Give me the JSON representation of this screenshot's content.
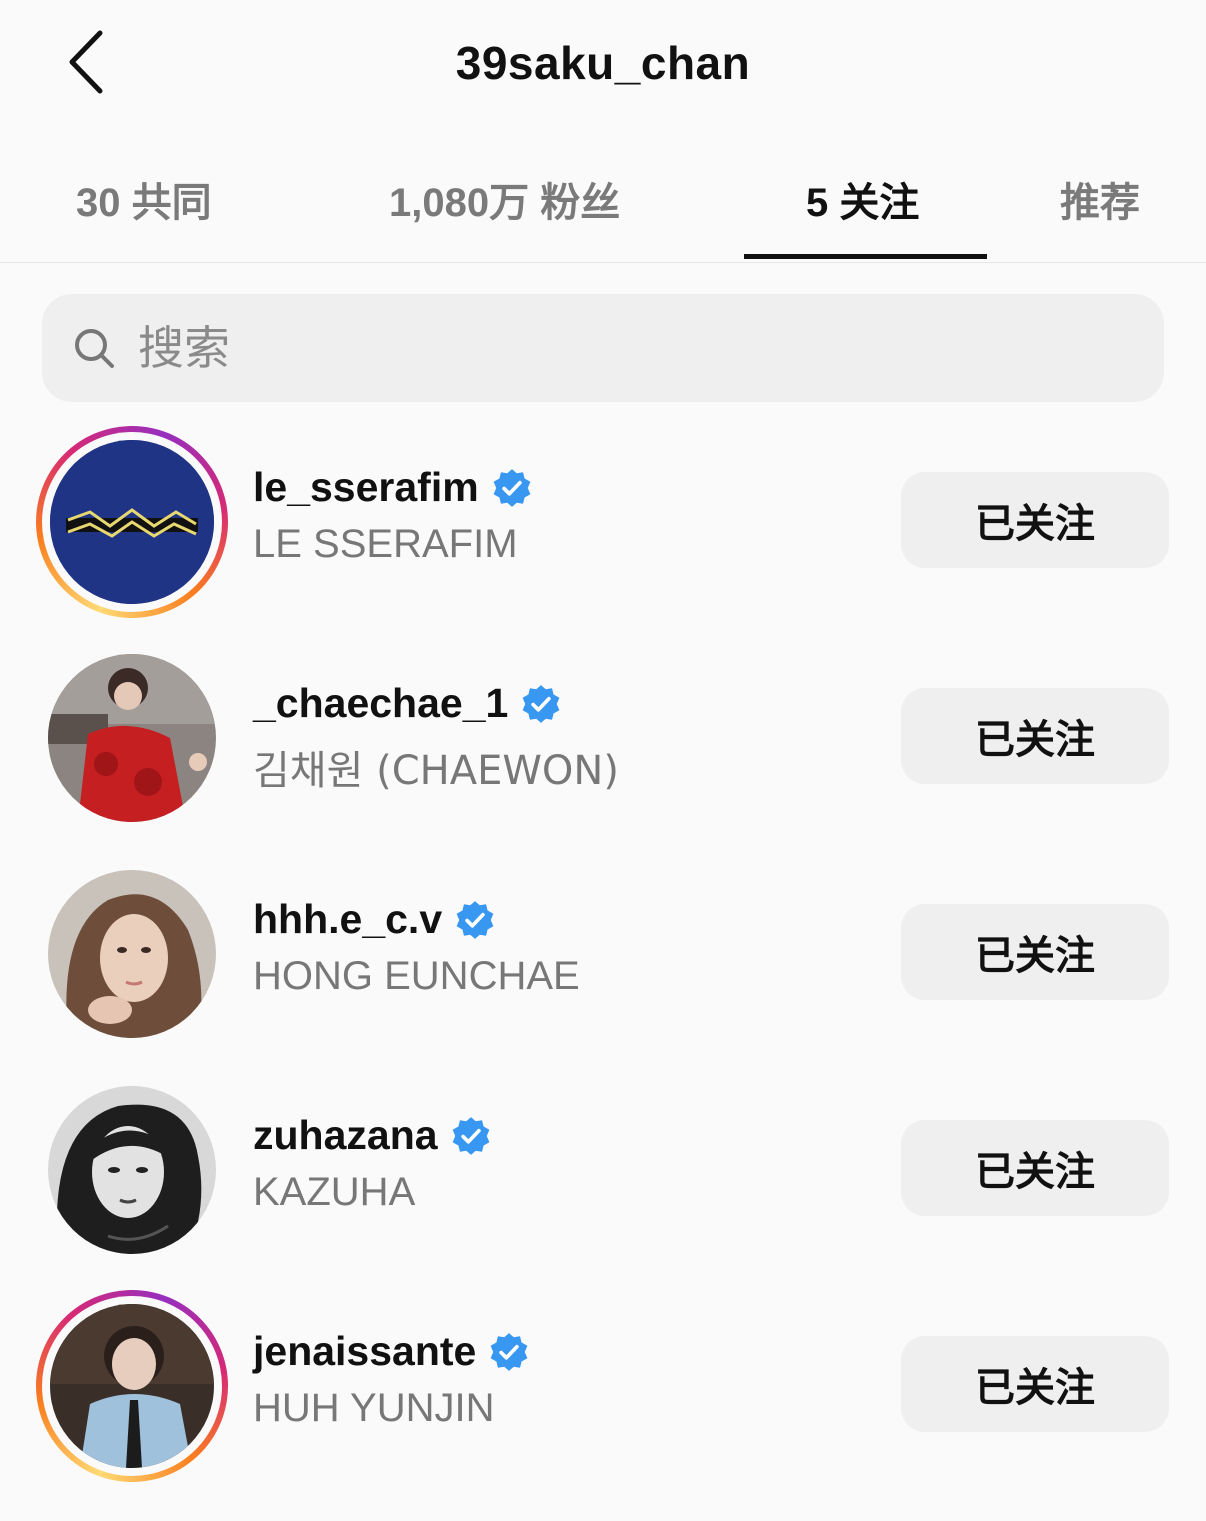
{
  "header": {
    "title": "39saku_chan"
  },
  "tabs": [
    {
      "label": "30 共同"
    },
    {
      "label": "1,080万 粉丝"
    },
    {
      "label": "5 关注"
    },
    {
      "label": "推荐"
    }
  ],
  "search": {
    "placeholder": "搜索"
  },
  "accounts": [
    {
      "username": "le_sserafim",
      "full_name": "LE SSERAFIM",
      "button": "已关注",
      "verified": true
    },
    {
      "username": "_chaechae_1",
      "full_name": "김채원 (CHAEWON)",
      "button": "已关注",
      "verified": true
    },
    {
      "username": "hhh.e_c.v",
      "full_name": "HONG EUNCHAE",
      "button": "已关注",
      "verified": true
    },
    {
      "username": "zuhazana",
      "full_name": "KAZUHA",
      "button": "已关注",
      "verified": true
    },
    {
      "username": "jenaissante",
      "full_name": "HUH YUNJIN",
      "button": "已关注",
      "verified": true
    }
  ],
  "colors": {
    "background": "#fafafa",
    "button_bg": "#efefef",
    "verified_blue": "#3897f0",
    "secondary_text": "#777777"
  }
}
